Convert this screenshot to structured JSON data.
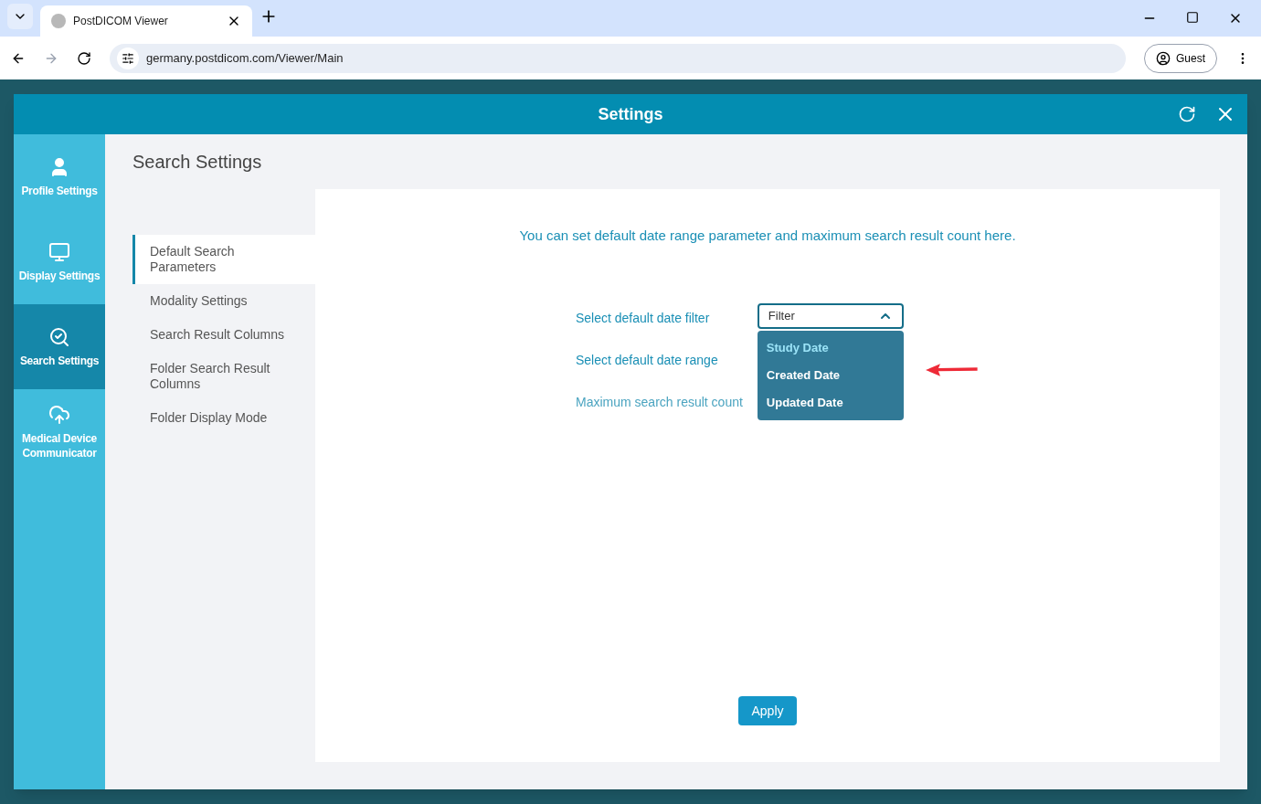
{
  "browser": {
    "tab_title": "PostDICOM Viewer",
    "url": "germany.postdicom.com/Viewer/Main",
    "profile": "Guest"
  },
  "dialog": {
    "title": "Settings",
    "nav": [
      {
        "label": "Profile Settings",
        "kind": "profile",
        "selected": false
      },
      {
        "label": "Display Settings",
        "kind": "display",
        "selected": false
      },
      {
        "label": "Search Settings",
        "kind": "search",
        "selected": true
      },
      {
        "label": "Medical Device Communicator",
        "kind": "cloud",
        "selected": false
      }
    ],
    "heading": "Search Settings",
    "submenu": [
      {
        "label": "Default Search Parameters",
        "selected": true
      },
      {
        "label": "Modality Settings",
        "selected": false
      },
      {
        "label": "Search Result Columns",
        "selected": false
      },
      {
        "label": "Folder Search Result Columns",
        "selected": false
      },
      {
        "label": "Folder Display Mode",
        "selected": false
      }
    ],
    "intro": "You can set default date range parameter and maximum search result count here.",
    "fields": [
      {
        "label": "Select default date filter"
      },
      {
        "label": "Select default date range"
      },
      {
        "label": "Maximum search result count"
      }
    ],
    "dropdown": {
      "value": "Filter",
      "expanded": true,
      "options": [
        {
          "label": "Study Date",
          "selected": true
        },
        {
          "label": "Created Date",
          "selected": false
        },
        {
          "label": "Updated Date",
          "selected": false
        }
      ]
    },
    "apply": "Apply"
  }
}
